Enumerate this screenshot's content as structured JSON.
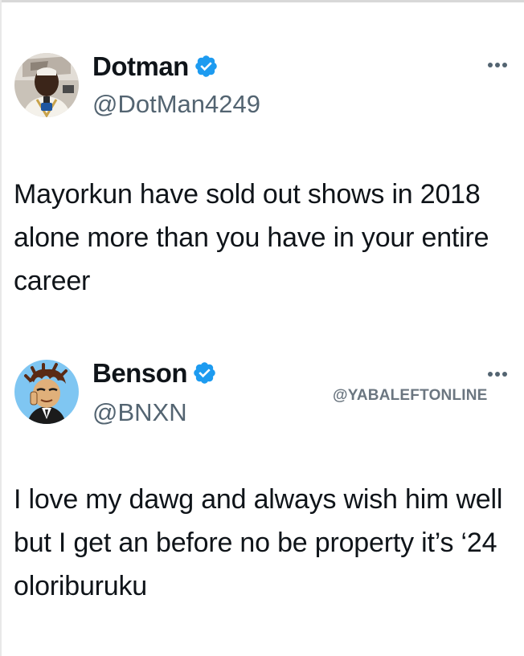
{
  "tweets": [
    {
      "display_name": "Dotman",
      "handle": "@DotMan4249",
      "text": "Mayorkun have sold out shows in 2018 alone more than you have in your entire career"
    },
    {
      "display_name": "Benson",
      "handle": "@BNXN",
      "text": "I love my dawg and always wish him well but I get an before no be property it’s ‘24  oloriburuku"
    }
  ],
  "watermark": "@YABALEFTONLINE",
  "icons": {
    "verified": "verified-badge-icon",
    "more": "more-options-icon"
  },
  "colors": {
    "verified_blue": "#1d9bf0",
    "text": "#0f1419",
    "handle_gray": "#536471"
  }
}
